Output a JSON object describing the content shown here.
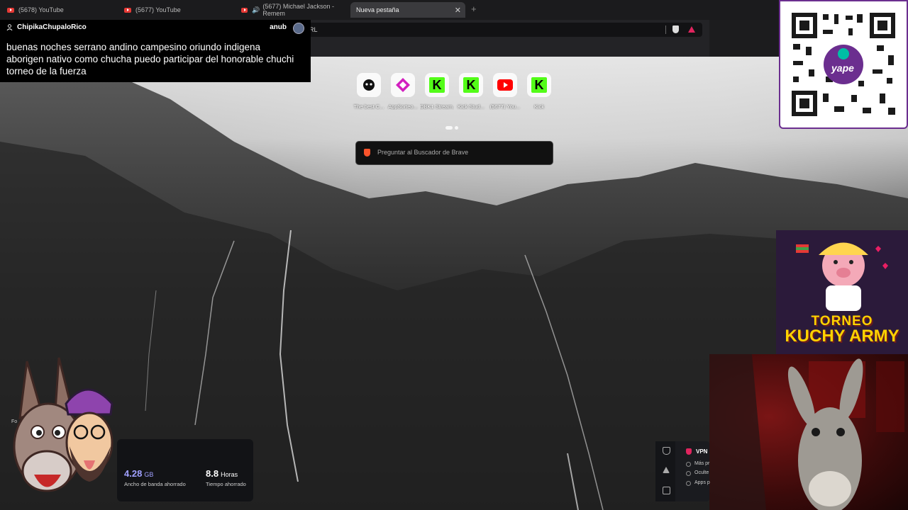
{
  "tabs": [
    {
      "label": "(5678) YouTube",
      "icon": "youtube-icon"
    },
    {
      "label": "(5677) YouTube",
      "icon": "youtube-icon"
    },
    {
      "label": "(5677) Michael Jackson - Remem",
      "icon": "youtube-icon",
      "audio": true
    },
    {
      "label": "Nueva pestaña",
      "active": true
    }
  ],
  "new_tab_symbol": "+",
  "address_bar": {
    "text": "RL"
  },
  "chat": {
    "username": "ChipikaChupaloRico",
    "channel": "anub",
    "message": "buenas noches serrano andino campesino oriundo indigena aborigen nativo como chucha puedo participar del honorable chuchi torneo de la fuerza"
  },
  "shortcuts": [
    {
      "label": "The best C...",
      "icon": "gear-bot-icon"
    },
    {
      "label": "AppSorteo...",
      "icon": "appsorteo-icon"
    },
    {
      "label": "DBK1 Stream...",
      "icon": "kick-icon"
    },
    {
      "label": "Kick Stud...",
      "icon": "kick-icon"
    },
    {
      "label": "(5677) You...",
      "icon": "youtube-icon"
    },
    {
      "label": "Kick",
      "icon": "kick-icon"
    }
  ],
  "search": {
    "placeholder": "Preguntar al Buscador de Brave"
  },
  "stats": {
    "bandwidth_value": "4.28",
    "bandwidth_unit": "GB",
    "bandwidth_label": "Ancho de banda ahorrado",
    "time_value": "8.8",
    "time_unit": "Horas",
    "time_label": "Tiempo ahorrado"
  },
  "vpn": {
    "title": "VPN",
    "rows": [
      "Más pr",
      "Oculte",
      "Apps p"
    ]
  },
  "overlay": {
    "qr_brand": "yape",
    "tournament_line1": "TORNEO",
    "tournament_line2": "KUCHY ARMY"
  },
  "fo_text": "Fo"
}
